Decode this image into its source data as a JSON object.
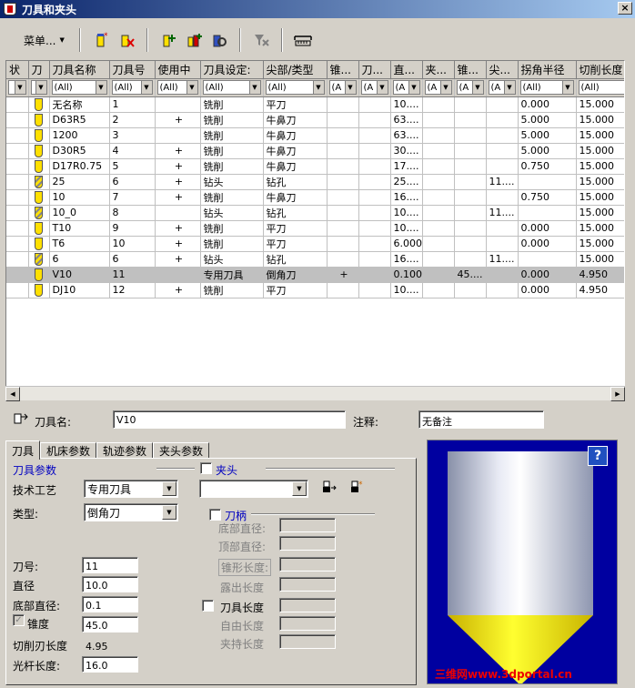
{
  "window": {
    "title": "刀具和夹头",
    "close": "×"
  },
  "toolbar": {
    "menu_label": "菜单..."
  },
  "grid": {
    "columns": [
      "状",
      "刀",
      "刀具名称",
      "刀具号",
      "使用中",
      "刀具设定:",
      "尖部/类型",
      "锥...",
      "刀...",
      "直...",
      "夹...",
      "锥...",
      "尖...",
      "拐角半径",
      "切削长度"
    ],
    "filters": [
      "",
      "",
      "(All)",
      "(All)",
      "(All)",
      "(All)",
      "(All)",
      "(A",
      "(A",
      "(A",
      "(A",
      "(A",
      "(A",
      "(All)",
      "(All)"
    ],
    "rows": [
      {
        "name": "无名称",
        "num": "1",
        "used": "",
        "setting": "铣削",
        "type": "平刀",
        "c7": "",
        "c8": "",
        "dia": "10....",
        "c10": "",
        "c11": "",
        "c12": "",
        "corner": "0.000",
        "cut": "15.000",
        "icon": "mill"
      },
      {
        "name": "D63R5",
        "num": "2",
        "used": "+",
        "setting": "铣削",
        "type": "牛鼻刀",
        "c7": "",
        "c8": "",
        "dia": "63....",
        "c10": "",
        "c11": "",
        "c12": "",
        "corner": "5.000",
        "cut": "15.000",
        "icon": "mill"
      },
      {
        "name": "1200",
        "num": "3",
        "used": "",
        "setting": "铣削",
        "type": "牛鼻刀",
        "c7": "",
        "c8": "",
        "dia": "63....",
        "c10": "",
        "c11": "",
        "c12": "",
        "corner": "5.000",
        "cut": "15.000",
        "icon": "mill"
      },
      {
        "name": "D30R5",
        "num": "4",
        "used": "+",
        "setting": "铣削",
        "type": "牛鼻刀",
        "c7": "",
        "c8": "",
        "dia": "30....",
        "c10": "",
        "c11": "",
        "c12": "",
        "corner": "5.000",
        "cut": "15.000",
        "icon": "mill"
      },
      {
        "name": "D17R0.75",
        "num": "5",
        "used": "+",
        "setting": "铣削",
        "type": "牛鼻刀",
        "c7": "",
        "c8": "",
        "dia": "17....",
        "c10": "",
        "c11": "",
        "c12": "",
        "corner": "0.750",
        "cut": "15.000",
        "icon": "mill"
      },
      {
        "name": "25",
        "num": "6",
        "used": "+",
        "setting": "钻头",
        "type": "钻孔",
        "c7": "",
        "c8": "",
        "dia": "25....",
        "c10": "",
        "c11": "",
        "c12": "11....",
        "corner": "",
        "cut": "15.000",
        "icon": "drill"
      },
      {
        "name": "10",
        "num": "7",
        "used": "+",
        "setting": "铣削",
        "type": "牛鼻刀",
        "c7": "",
        "c8": "",
        "dia": "16....",
        "c10": "",
        "c11": "",
        "c12": "",
        "corner": "0.750",
        "cut": "15.000",
        "icon": "mill"
      },
      {
        "name": "10_0",
        "num": "8",
        "used": "",
        "setting": "钻头",
        "type": "钻孔",
        "c7": "",
        "c8": "",
        "dia": "10....",
        "c10": "",
        "c11": "",
        "c12": "11....",
        "corner": "",
        "cut": "15.000",
        "icon": "drill"
      },
      {
        "name": "T10",
        "num": "9",
        "used": "+",
        "setting": "铣削",
        "type": "平刀",
        "c7": "",
        "c8": "",
        "dia": "10....",
        "c10": "",
        "c11": "",
        "c12": "",
        "corner": "0.000",
        "cut": "15.000",
        "icon": "mill"
      },
      {
        "name": "T6",
        "num": "10",
        "used": "+",
        "setting": "铣削",
        "type": "平刀",
        "c7": "",
        "c8": "",
        "dia": "6.000",
        "c10": "",
        "c11": "",
        "c12": "",
        "corner": "0.000",
        "cut": "15.000",
        "icon": "mill"
      },
      {
        "name": "6",
        "num": "6",
        "used": "+",
        "setting": "钻头",
        "type": "钻孔",
        "c7": "",
        "c8": "",
        "dia": "16....",
        "c10": "",
        "c11": "",
        "c12": "11....",
        "corner": "",
        "cut": "15.000",
        "icon": "drill"
      },
      {
        "name": "V10",
        "num": "11",
        "used": "",
        "setting": "专用刀具",
        "type": "倒角刀",
        "c7": "+",
        "c8": "",
        "dia": "0.100",
        "c10": "",
        "c11": "45....",
        "c12": "",
        "corner": "0.000",
        "cut": "4.950",
        "icon": "mill",
        "selected": true
      },
      {
        "name": "DJ10",
        "num": "12",
        "used": "+",
        "setting": "铣削",
        "type": "平刀",
        "c7": "",
        "c8": "",
        "dia": "10....",
        "c10": "",
        "c11": "",
        "c12": "",
        "corner": "0.000",
        "cut": "4.950",
        "icon": "mill"
      }
    ]
  },
  "form": {
    "tool_name_label": "刀具名:",
    "tool_name_value": "V10",
    "note_label": "注释:",
    "note_value": "无备注",
    "tabs": [
      "刀具",
      "机床参数",
      "轨迹参数",
      "夹头参数"
    ],
    "tool_params_title": "刀具参数",
    "holder_label": "夹头",
    "tech_label": "技术工艺",
    "tech_value": "专用刀具",
    "type_label": "类型:",
    "type_value": "倒角刀",
    "shank_label": "刀柄",
    "bottom_dia_label": "底部直径:",
    "top_dia_label": "顶部直径:",
    "taper_len_label": "锥形长度:",
    "exposed_len_label": "露出长度",
    "tool_len_label": "刀具长度",
    "free_len_label": "自由长度",
    "clamp_len_label": "夹持长度",
    "tool_no_label": "刀号:",
    "tool_no_value": "11",
    "dia_label": "直径",
    "dia_value": "10.0",
    "bot_dia_label": "底部直径:",
    "bot_dia_value": "0.1",
    "taper_label": "锥度",
    "taper_value": "45.0",
    "cut_len_label": "切削刃长度",
    "cut_len_value": "4.95",
    "shank_len_label": "光杆长度:",
    "shank_len_value": "16.0"
  },
  "preview": {
    "help": "?",
    "watermark": "三维网www.3dportal.cn"
  }
}
